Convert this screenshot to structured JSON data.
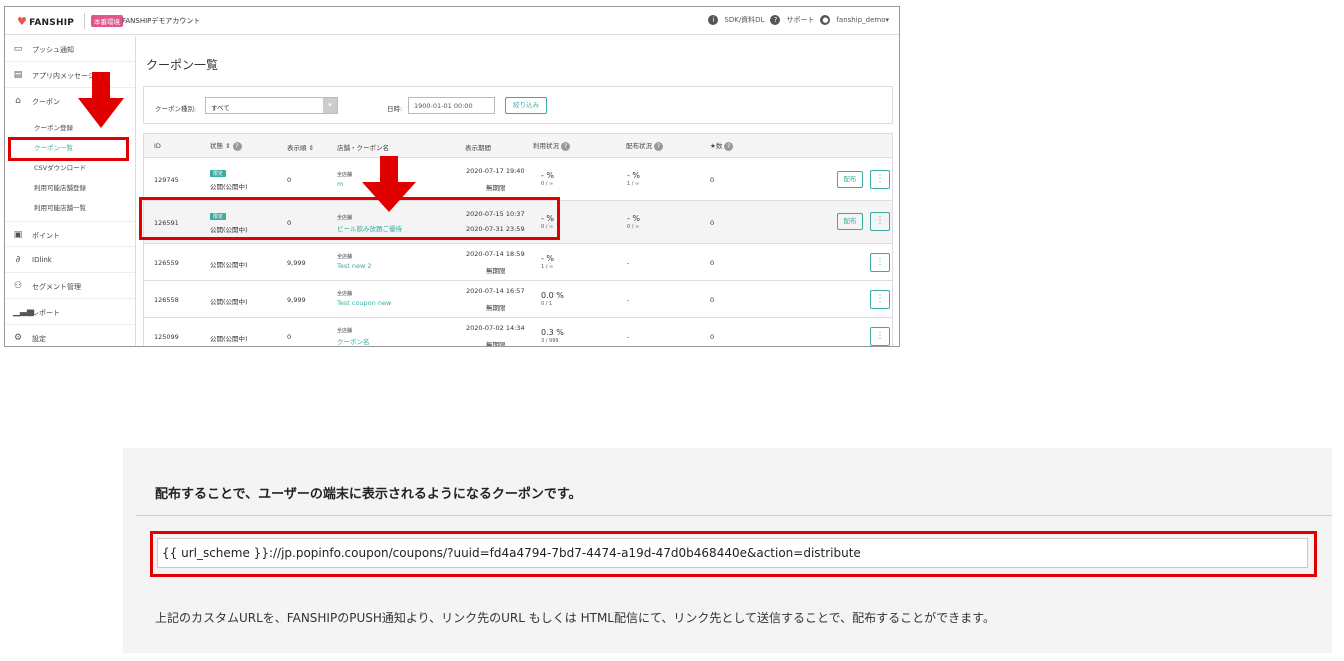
{
  "app": {
    "logo": "FANSHIP",
    "env_badge": "本番環境",
    "account_name": "FANSHIPデモアカウント",
    "top_right": {
      "sdk": "SDK/資料DL",
      "support": "サポート",
      "user": "fanship_demo"
    }
  },
  "sidebar": {
    "items": [
      {
        "label": "プッシュ通知",
        "icon": "message-icon"
      },
      {
        "label": "アプリ内メッセージ",
        "icon": "document-icon"
      },
      {
        "label": "クーポン",
        "icon": "ticket-icon"
      },
      {
        "label": "ポイント",
        "icon": "points-icon"
      },
      {
        "label": "IDlink",
        "icon": "link-icon"
      },
      {
        "label": "セグメント管理",
        "icon": "users-icon"
      },
      {
        "label": "レポート",
        "icon": "bar-chart-icon"
      },
      {
        "label": "設定",
        "icon": "gear-icon"
      }
    ],
    "coupon_sub": [
      "クーポン登録",
      "クーポン一覧",
      "CSVダウンロード",
      "利用可能店舗登録",
      "利用可能店舗一覧"
    ]
  },
  "main": {
    "title": "クーポン一覧",
    "filter": {
      "type_label": "クーポン種別:",
      "type_value": "すべて",
      "date_label": "日時:",
      "date_value": "1900-01-01 00:00",
      "button": "絞り込み"
    },
    "table": {
      "headers": [
        "ID",
        "状態 ⇕",
        "表示順 ⇕",
        "店舗・クーポン名",
        "表示期間",
        "利用状況",
        "配布状況",
        "★数"
      ],
      "rows": [
        {
          "id": "129745",
          "badge": "限定",
          "status": "公開(公開中)",
          "order": "0",
          "store": "全店舗",
          "name": "m",
          "period_start": "2020-07-17 19:40",
          "period_end": "無期限",
          "usage_pct": "- %",
          "usage_sub": "0 / ∞",
          "dist_pct": "- %",
          "dist_sub": "1 / ∞",
          "stars": "0",
          "dist_btn": "配布"
        },
        {
          "id": "126591",
          "badge": "限定",
          "status": "公開(公開中)",
          "order": "0",
          "store": "全店舗",
          "name": "ビール飲み放題ご優待",
          "period_start": "2020-07-15 10:37",
          "period_end": "2020-07-31 23:59",
          "usage_pct": "- %",
          "usage_sub": "0 / ∞",
          "dist_pct": "- %",
          "dist_sub": "0 / ∞",
          "stars": "0",
          "dist_btn": "配布"
        },
        {
          "id": "126559",
          "badge": "",
          "status": "公開(公開中)",
          "order": "9,999",
          "store": "全店舗",
          "name": "Test new 2",
          "period_start": "2020-07-14 18:59",
          "period_end": "無期限",
          "usage_pct": "- %",
          "usage_sub": "1 / ∞",
          "dist_pct": "-",
          "dist_sub": "",
          "stars": "0",
          "dist_btn": ""
        },
        {
          "id": "126558",
          "badge": "",
          "status": "公開(公開中)",
          "order": "9,999",
          "store": "全店舗",
          "name": "Test coupon new",
          "period_start": "2020-07-14 16:57",
          "period_end": "無期限",
          "usage_pct": "0.0 %",
          "usage_sub": "0 / 1",
          "dist_pct": "-",
          "dist_sub": "",
          "stars": "0",
          "dist_btn": ""
        },
        {
          "id": "125099",
          "badge": "",
          "status": "公開(公開中)",
          "order": "0",
          "store": "全店舗",
          "name": "クーポン名",
          "period_start": "2020-07-02 14:34",
          "period_end": "無期限",
          "usage_pct": "0.3 %",
          "usage_sub": "3 / 999",
          "dist_pct": "-",
          "dist_sub": "",
          "stars": "0",
          "dist_btn": ""
        }
      ],
      "more_label": "⋮"
    }
  },
  "panel": {
    "title": "配布することで、ユーザーの端末に表示されるようになるクーポンです。",
    "url": "{{ url_scheme }}://jp.popinfo.coupon/coupons/?uuid=fd4a4794-7bd7-4474-a19d-47d0b468440e&action=distribute",
    "note": "上記のカスタムURLを、FANSHIPのPUSH通知より、リンク先のURL もしくは HTML配信にて、リンク先として送信することで、配布することができます。"
  },
  "colors": {
    "accent": "#3aaba2",
    "highlight": "#e00000",
    "env_badge": "#e0578b"
  }
}
